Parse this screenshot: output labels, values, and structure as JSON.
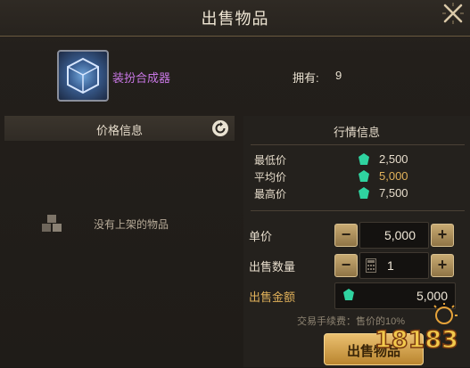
{
  "window": {
    "title": "出售物品"
  },
  "item": {
    "name": "装扮合成器",
    "owned_label": "拥有:",
    "owned_value": "9"
  },
  "left": {
    "header": "价格信息",
    "empty_text": "没有上架的物品"
  },
  "market": {
    "title": "行情信息",
    "stats": [
      {
        "label": "最低价",
        "value": "2,500"
      },
      {
        "label": "平均价",
        "value": "5,000"
      },
      {
        "label": "最高价",
        "value": "7,500"
      }
    ]
  },
  "form": {
    "unit_price_label": "单价",
    "unit_price": "5,000",
    "quantity_label": "出售数量",
    "quantity": "1",
    "total_label": "出售金额",
    "total": "5,000",
    "fee_text": "交易手续费：售价的10%",
    "sell_label": "出售物品"
  },
  "watermark": {
    "text": "18183"
  },
  "colors": {
    "accent": "#c978e6",
    "gold": "#e0b15a",
    "gem": "#2fd3a0"
  }
}
